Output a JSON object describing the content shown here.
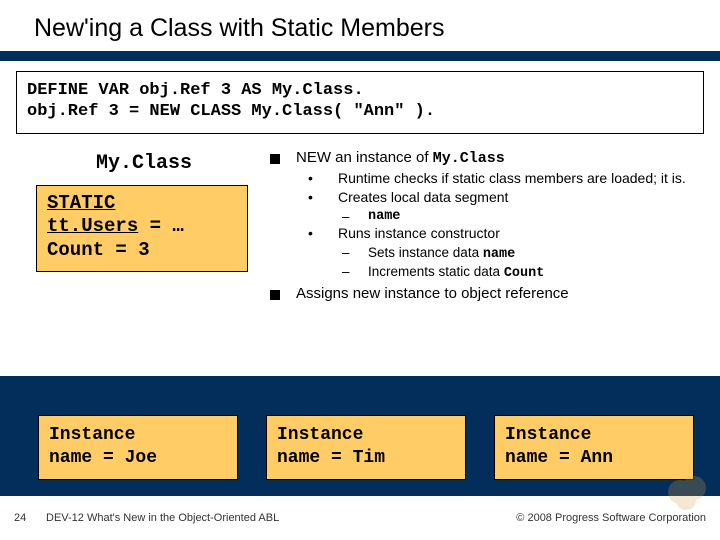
{
  "title": "New'ing a Class with Static Members",
  "code_line1": "DEFINE VAR obj.Ref 3 AS My.Class.",
  "code_line2": "obj.Ref 3 = NEW CLASS My.Class( \"Ann\" ).",
  "class_name": "My.Class",
  "static_box": {
    "static_label": "STATIC",
    "ttusers_label": "tt.Users",
    "ttusers_rhs": " = …",
    "count_line": "Count    = 3"
  },
  "bullets": {
    "b1_prefix": "NEW an instance of ",
    "b1_mono": "My.Class",
    "s1": "Runtime checks if static class members are loaded; it is.",
    "s2": "Creates local data segment",
    "s2a": "name",
    "s3": "Runs instance constructor",
    "s3a_prefix": "Sets instance data ",
    "s3a_mono": "name",
    "s3b_prefix": "Increments static data ",
    "s3b_mono": "Count",
    "b2": "Assigns new instance to object reference"
  },
  "instances": [
    {
      "l1": "Instance",
      "l2": "name  = Joe"
    },
    {
      "l1": "Instance",
      "l2": "name  = Tim"
    },
    {
      "l1": "Instance",
      "l2": "name  = Ann"
    }
  ],
  "footer": {
    "pagenum": "24",
    "left": "DEV-12 What's New in the Object-Oriented ABL",
    "right": "© 2008 Progress Software Corporation"
  }
}
